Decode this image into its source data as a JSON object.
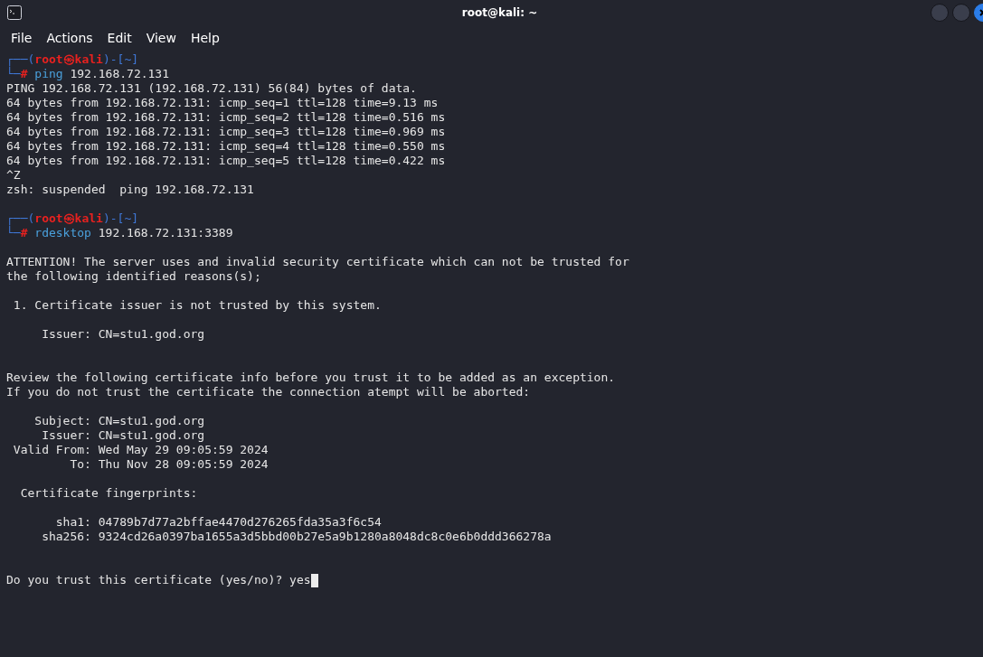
{
  "window": {
    "title": "root@kali: ~"
  },
  "menu": [
    "File",
    "Actions",
    "Edit",
    "View",
    "Help"
  ],
  "lines": [
    {
      "kind": "output",
      "segments": [
        {
          "kind": "frame",
          "text": "┌──("
        },
        {
          "kind": "user",
          "text": "root㉿kali"
        },
        {
          "kind": "frame",
          "text": ")-[~]"
        }
      ]
    },
    {
      "kind": "output",
      "segments": [
        {
          "kind": "frame",
          "text": "└─"
        },
        {
          "kind": "user",
          "text": "# "
        },
        {
          "kind": "command",
          "text": "ping"
        },
        {
          "kind": "text",
          "text": " 192.168.72.131"
        }
      ]
    },
    {
      "kind": "output",
      "segments": [
        {
          "kind": "text",
          "text": "PING 192.168.72.131 (192.168.72.131) 56(84) bytes of data."
        }
      ]
    },
    {
      "kind": "output",
      "segments": [
        {
          "kind": "text",
          "text": "64 bytes from 192.168.72.131: icmp_seq=1 ttl=128 time=9.13 ms"
        }
      ]
    },
    {
      "kind": "output",
      "segments": [
        {
          "kind": "text",
          "text": "64 bytes from 192.168.72.131: icmp_seq=2 ttl=128 time=0.516 ms"
        }
      ]
    },
    {
      "kind": "output",
      "segments": [
        {
          "kind": "text",
          "text": "64 bytes from 192.168.72.131: icmp_seq=3 ttl=128 time=0.969 ms"
        }
      ]
    },
    {
      "kind": "output",
      "segments": [
        {
          "kind": "text",
          "text": "64 bytes from 192.168.72.131: icmp_seq=4 ttl=128 time=0.550 ms"
        }
      ]
    },
    {
      "kind": "output",
      "segments": [
        {
          "kind": "text",
          "text": "64 bytes from 192.168.72.131: icmp_seq=5 ttl=128 time=0.422 ms"
        }
      ]
    },
    {
      "kind": "output",
      "segments": [
        {
          "kind": "text",
          "text": "^Z"
        }
      ]
    },
    {
      "kind": "output",
      "segments": [
        {
          "kind": "text",
          "text": "zsh: suspended  ping 192.168.72.131"
        }
      ]
    },
    {
      "kind": "blank"
    },
    {
      "kind": "output",
      "segments": [
        {
          "kind": "frame",
          "text": "┌──("
        },
        {
          "kind": "user",
          "text": "root㉿kali"
        },
        {
          "kind": "frame",
          "text": ")-[~]"
        }
      ]
    },
    {
      "kind": "output",
      "segments": [
        {
          "kind": "frame",
          "text": "└─"
        },
        {
          "kind": "user",
          "text": "# "
        },
        {
          "kind": "command",
          "text": "rdesktop"
        },
        {
          "kind": "text",
          "text": " 192.168.72.131:3389"
        }
      ]
    },
    {
      "kind": "blank"
    },
    {
      "kind": "output",
      "segments": [
        {
          "kind": "text",
          "text": "ATTENTION! The server uses and invalid security certificate which can not be trusted for"
        }
      ]
    },
    {
      "kind": "output",
      "segments": [
        {
          "kind": "text",
          "text": "the following identified reasons(s);"
        }
      ]
    },
    {
      "kind": "blank"
    },
    {
      "kind": "output",
      "segments": [
        {
          "kind": "text",
          "text": " 1. Certificate issuer is not trusted by this system."
        }
      ]
    },
    {
      "kind": "blank"
    },
    {
      "kind": "output",
      "segments": [
        {
          "kind": "text",
          "text": "     Issuer: CN=stu1.god.org"
        }
      ]
    },
    {
      "kind": "blank"
    },
    {
      "kind": "blank"
    },
    {
      "kind": "output",
      "segments": [
        {
          "kind": "text",
          "text": "Review the following certificate info before you trust it to be added as an exception."
        }
      ]
    },
    {
      "kind": "output",
      "segments": [
        {
          "kind": "text",
          "text": "If you do not trust the certificate the connection atempt will be aborted:"
        }
      ]
    },
    {
      "kind": "blank"
    },
    {
      "kind": "output",
      "segments": [
        {
          "kind": "text",
          "text": "    Subject: CN=stu1.god.org"
        }
      ]
    },
    {
      "kind": "output",
      "segments": [
        {
          "kind": "text",
          "text": "     Issuer: CN=stu1.god.org"
        }
      ]
    },
    {
      "kind": "output",
      "segments": [
        {
          "kind": "text",
          "text": " Valid From: Wed May 29 09:05:59 2024"
        }
      ]
    },
    {
      "kind": "output",
      "segments": [
        {
          "kind": "text",
          "text": "         To: Thu Nov 28 09:05:59 2024"
        }
      ]
    },
    {
      "kind": "blank"
    },
    {
      "kind": "output",
      "segments": [
        {
          "kind": "text",
          "text": "  Certificate fingerprints:"
        }
      ]
    },
    {
      "kind": "blank"
    },
    {
      "kind": "output",
      "segments": [
        {
          "kind": "text",
          "text": "       sha1: 04789b7d77a2bffae4470d276265fda35a3f6c54"
        }
      ]
    },
    {
      "kind": "output",
      "segments": [
        {
          "kind": "text",
          "text": "     sha256: 9324cd26a0397ba1655a3d5bbd00b27e5a9b1280a8048dc8c0e6b0ddd366278a"
        }
      ]
    },
    {
      "kind": "blank"
    },
    {
      "kind": "blank"
    },
    {
      "kind": "input",
      "segments": [
        {
          "kind": "text",
          "text": "Do you trust this certificate (yes/no)? yes"
        }
      ]
    }
  ]
}
